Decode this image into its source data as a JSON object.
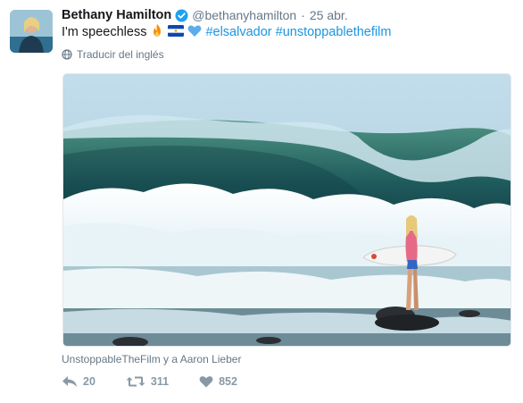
{
  "tweet": {
    "author_name": "Bethany Hamilton",
    "handle": "@bethanyhamilton",
    "separator": "·",
    "date": "25 abr.",
    "text_prefix": "I'm speechless",
    "hashtags": [
      "#elsalvador",
      "#unstoppablethefilm"
    ],
    "emojis": [
      "fire-emoji",
      "el-salvador-flag-emoji",
      "blue-heart-emoji"
    ],
    "translate_label": "Traducir del inglés",
    "media_credit": "UnstoppableTheFilm y a Aaron Lieber",
    "actions": {
      "reply_count": "20",
      "retweet_count": "311",
      "like_count": "852"
    },
    "colors": {
      "hashtag": "#1b95e0",
      "verified": "#1da1f2",
      "muted": "#657786",
      "action_icon": "#8899a6"
    }
  }
}
